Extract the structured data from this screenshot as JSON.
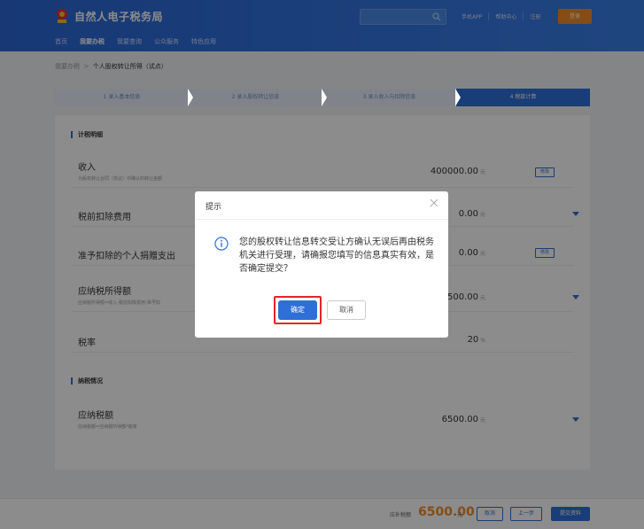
{
  "header": {
    "brand": "自然人电子税务局",
    "links": [
      "手机APP",
      "帮助中心",
      "注册"
    ],
    "login_label": "登录",
    "nav": [
      "首页",
      "我要办税",
      "我要查询",
      "公众服务",
      "特色应用"
    ]
  },
  "breadcrumb": {
    "parent": "我要办税",
    "separator": ">",
    "current": "个人股权转让所得（试点）"
  },
  "steps": [
    "1  录入基本信息",
    "2  录入股权转让信息",
    "3  录入收入与扣除信息",
    "4  税款计算"
  ],
  "section_calc": "计税明细",
  "rows": [
    {
      "label": "收入",
      "sub": "为股权转让合同（协议）中确认的转让金额",
      "value": "400000.00",
      "unit": "元",
      "action": "修改"
    },
    {
      "label": "税前扣除费用",
      "value": "0.00",
      "unit": "元"
    },
    {
      "label": "准予扣除的个人捐赠支出",
      "value": "0.00",
      "unit": "元",
      "action": "修改"
    },
    {
      "label": "应纳税所得额",
      "sub": "应纳税所得额=收入-税前扣除费用-准予扣",
      "value": "6500.00",
      "unit": "元"
    },
    {
      "label": "税率",
      "value": "20",
      "unit": "%"
    }
  ],
  "section_pay": "纳税情况",
  "pay_row": {
    "label": "应纳税额",
    "sub": "应纳税额=应纳税所得额*税率",
    "value": "6500.00",
    "unit": "元"
  },
  "footer": {
    "label": "应补税额",
    "amount": "6500.00",
    "unit": "元",
    "cancel": "取消",
    "prev": "上一步",
    "submit": "提交资料"
  },
  "dialog": {
    "title": "提示",
    "message": "您的股权转让信息转交受让方确认无误后再由税务机关进行受理，请确报您填写的信息真实有效，是否确定提交？",
    "ok": "确定",
    "cancel": "取消"
  },
  "colors": {
    "primary": "#2f6fd8",
    "accent": "#f08c2a",
    "highlight": "#e6232a"
  }
}
